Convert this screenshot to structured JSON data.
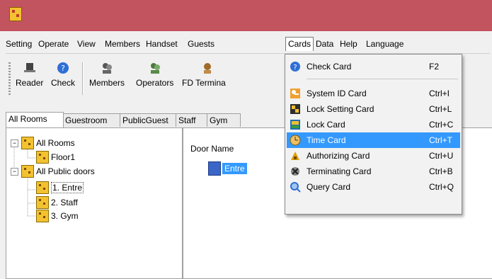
{
  "menubar": {
    "items": [
      "Setting",
      "Operate",
      "View",
      "Members",
      "Handset",
      "Guests",
      "Cards",
      "Data",
      "Help",
      "Language"
    ]
  },
  "toolbar": {
    "buttons": [
      {
        "label": "Reader",
        "icon": "reader-icon"
      },
      {
        "label": "Check",
        "icon": "check-icon"
      },
      {
        "label": "Members",
        "icon": "members-icon"
      },
      {
        "label": "Operators",
        "icon": "operators-icon"
      },
      {
        "label": "FD Termina",
        "icon": "fd-terminal-icon"
      }
    ]
  },
  "tabs": [
    "All Rooms",
    "Guestroom",
    "PublicGuest",
    "Staff",
    "Gym"
  ],
  "tree": {
    "nodes": [
      {
        "label": "All Rooms",
        "expander": "−"
      },
      {
        "label": "Floor1"
      },
      {
        "label": "All Public doors",
        "expander": "−"
      },
      {
        "label": "1. Entre"
      },
      {
        "label": "2. Staff"
      },
      {
        "label": "3. Gym"
      }
    ]
  },
  "content": {
    "column_header": "Door Name",
    "doors": [
      "Entre"
    ]
  },
  "cards_menu": {
    "items": [
      {
        "label": "Check Card",
        "shortcut": "F2",
        "icon": "question-icon",
        "color": "#2f6fd6"
      },
      {
        "label": "System ID Card",
        "shortcut": "Ctrl+I",
        "icon": "key-icon",
        "color": "#e08a1e"
      },
      {
        "label": "Lock Setting Card",
        "shortcut": "Ctrl+L",
        "icon": "lock-setting-icon",
        "color": "#d4b020"
      },
      {
        "label": "Lock Card",
        "shortcut": "Ctrl+C",
        "icon": "lock-card-icon",
        "color": "#2e7d32"
      },
      {
        "label": "Time Card",
        "shortcut": "Ctrl+T",
        "icon": "clock-icon",
        "color": "#c88a20"
      },
      {
        "label": "Authorizing Card",
        "shortcut": "Ctrl+U",
        "icon": "authorize-icon",
        "color": "#e0a000"
      },
      {
        "label": "Terminating Card",
        "shortcut": "Ctrl+B",
        "icon": "terminate-icon",
        "color": "#555555"
      },
      {
        "label": "Query Card",
        "shortcut": "Ctrl+Q",
        "icon": "query-icon",
        "color": "#2f6fd6"
      }
    ]
  },
  "colors": {
    "titlebar": "#c2545f",
    "highlight": "#3399ff"
  }
}
